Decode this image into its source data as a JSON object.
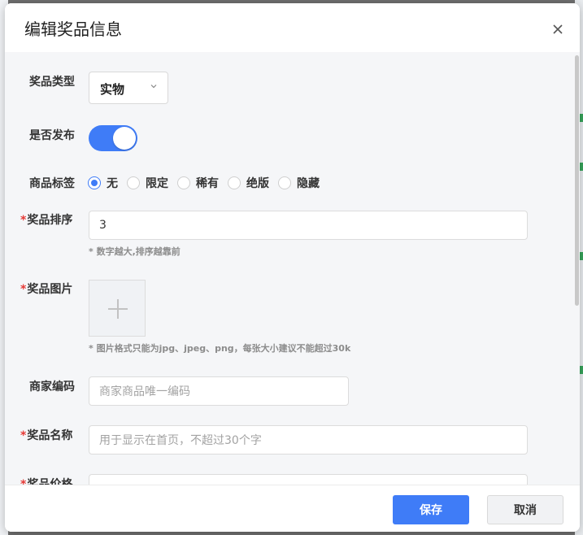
{
  "dialog": {
    "title": "编辑奖品信息",
    "close_icon": "close-icon"
  },
  "form": {
    "type": {
      "label": "奖品类型",
      "value": "实物"
    },
    "publish": {
      "label": "是否发布",
      "on": true
    },
    "tag": {
      "label": "商品标签",
      "options": [
        "无",
        "限定",
        "稀有",
        "绝版",
        "隐藏"
      ],
      "selected": "无"
    },
    "sort": {
      "label": "奖品排序",
      "value": "3",
      "hint": "* 数字越大,排序越靠前",
      "required": "*"
    },
    "image": {
      "label": "奖品图片",
      "hint": "* 图片格式只能为jpg、jpeg、png，每张大小建议不能超过30k",
      "required": "*"
    },
    "merchant_code": {
      "label": "商家编码",
      "placeholder": "商家商品唯一编码"
    },
    "name": {
      "label": "奖品名称",
      "placeholder": "用于显示在首页，不超过30个字",
      "required": "*"
    },
    "price": {
      "label": "奖品价格",
      "required": "*"
    }
  },
  "footer": {
    "save_label": "保存",
    "cancel_label": "取消"
  },
  "colors": {
    "primary": "#3f7cf7",
    "required": "#e53935"
  }
}
